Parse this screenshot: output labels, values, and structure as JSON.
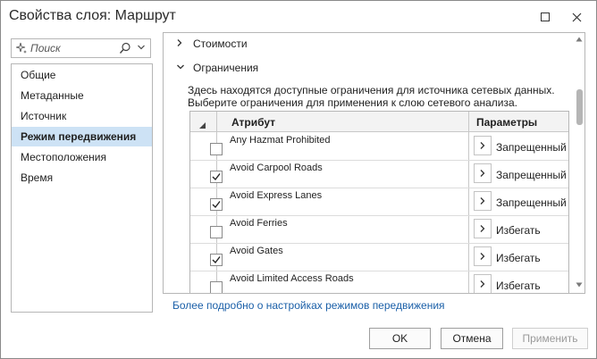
{
  "window": {
    "title": "Свойства слоя: Маршрут"
  },
  "search": {
    "placeholder": "Поиск"
  },
  "nav": {
    "items": [
      {
        "label": "Общие",
        "selected": false
      },
      {
        "label": "Метаданные",
        "selected": false
      },
      {
        "label": "Источник",
        "selected": false
      },
      {
        "label": "Режим передвижения",
        "selected": true
      },
      {
        "label": "Местоположения",
        "selected": false
      },
      {
        "label": "Время",
        "selected": false
      }
    ]
  },
  "sections": {
    "costs": {
      "label": "Стоимости",
      "expanded": false
    },
    "restrictions": {
      "label": "Ограничения",
      "expanded": true
    }
  },
  "restrictions": {
    "description_line1": "Здесь находятся доступные ограничения для источника сетевых данных.",
    "description_line2": "Выберите ограничения для применения к слою сетевого анализа.",
    "columns": {
      "attribute": "Атрибут",
      "parameters": "Параметры"
    },
    "rows": [
      {
        "name": "Any Hazmat Prohibited",
        "checked": false,
        "param": "Запрещенный"
      },
      {
        "name": "Avoid Carpool Roads",
        "checked": true,
        "param": "Запрещенный"
      },
      {
        "name": "Avoid Express Lanes",
        "checked": true,
        "param": "Запрещенный"
      },
      {
        "name": "Avoid Ferries",
        "checked": false,
        "param": "Избегать"
      },
      {
        "name": "Avoid Gates",
        "checked": true,
        "param": "Избегать"
      },
      {
        "name": "Avoid Limited Access Roads",
        "checked": false,
        "param": "Избегать"
      }
    ]
  },
  "footer": {
    "more_link": "Более подробно о настройках режимов передвижения",
    "ok": "OK",
    "cancel": "Отмена",
    "apply": "Применить",
    "apply_enabled": false
  },
  "colors": {
    "selection": "#cde2f5",
    "link": "#1a5fa8",
    "border": "#b6b6b6"
  },
  "icons": [
    "sparkle-icon",
    "search-icon",
    "chevron-down-icon",
    "chevron-right-icon",
    "checkmark-icon",
    "maximize-icon",
    "close-icon"
  ]
}
